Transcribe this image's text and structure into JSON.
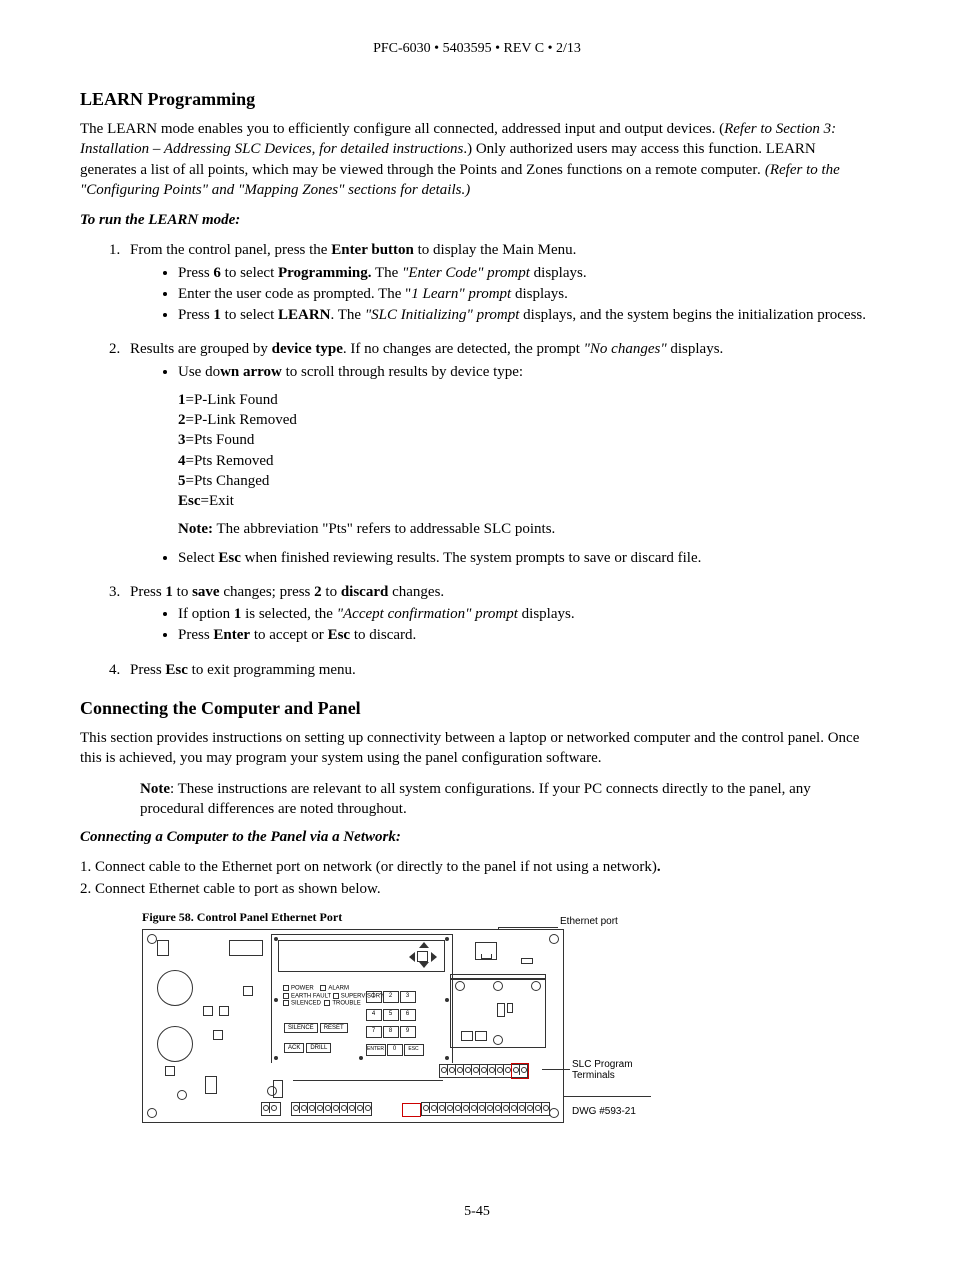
{
  "header": "PFC-6030 • 5403595 • REV C  • 2/13",
  "h1": "LEARN Programming",
  "p1a": "The LEARN mode enables you to efficiently configure all connected, addressed input and output devices. (",
  "p1b": "Refer to Section 3: Installation – Addressing SLC Devices, for detailed instructions",
  "p1c": ".) Only authorized users may access this function. LEARN generates a list of all points, which may be viewed through the Points and Zones functions on a remote computer",
  "p1d": ". (Refer to the \"Configuring Points\" and \"Mapping Zones\" sections for details.)",
  "sub1": "To run the LEARN mode:",
  "s1_lead_a": "From the control panel, press the ",
  "s1_lead_b": "Enter button",
  "s1_lead_c": " to display the Main Menu.",
  "s1_b1a": "Press ",
  "s1_b1b": "6",
  "s1_b1c": " to select ",
  "s1_b1d": "Programming.",
  "s1_b1e": " The ",
  "s1_b1f": "\"Enter Code\" prompt",
  "s1_b1g": " displays.",
  "s1_b2a": "Enter the user code as prompted. The \"",
  "s1_b2b": "1 Learn\" prompt",
  "s1_b2c": " displays.",
  "s1_b3a": "Press ",
  "s1_b3b": "1",
  "s1_b3c": " to select ",
  "s1_b3d": "LEARN",
  "s1_b3e": ". The ",
  "s1_b3f": "\"SLC Initializing\" prompt",
  "s1_b3g": " displays, and the system begins the initialization process.",
  "s2_lead_a": "Results are grouped by ",
  "s2_lead_b": "device type",
  "s2_lead_c": ". If no changes are detected, the prompt ",
  "s2_lead_d": "\"No changes\"",
  "s2_lead_e": " displays.",
  "s2_b1a": "Use do",
  "s2_b1b": "wn arrow",
  "s2_b1c": " to scroll through results by device type:",
  "codes": [
    {
      "k": "1",
      "v": "=P-Link Found"
    },
    {
      "k": "2",
      "v": "=P-Link Removed"
    },
    {
      "k": "3",
      "v": "=Pts Found"
    },
    {
      "k": "4",
      "v": "=Pts Removed"
    },
    {
      "k": "5",
      "v": "=Pts Changed"
    },
    {
      "k": "Esc",
      "v": "=Exit"
    }
  ],
  "note1a": "Note:",
  "note1b": " The abbreviation \"Pts\" refers to addressable SLC points.",
  "s2_b2a": "Select ",
  "s2_b2b": "Esc",
  "s2_b2c": " when finished reviewing results. The system prompts to save or discard file.",
  "s3_lead_a": "Press ",
  "s3_lead_b": "1",
  "s3_lead_c": " to ",
  "s3_lead_d": "save",
  "s3_lead_e": " changes; press ",
  "s3_lead_f": "2",
  "s3_lead_g": " to ",
  "s3_lead_h": "discard",
  "s3_lead_i": " changes.",
  "s3_b1a": "If option ",
  "s3_b1b": "1",
  "s3_b1c": " is selected, the ",
  "s3_b1d": "\"Accept confirmation\" prompt",
  "s3_b1e": " displays.",
  "s3_b2a": "Press ",
  "s3_b2b": "Enter",
  "s3_b2c": " to accept or ",
  "s3_b2d": "Esc",
  "s3_b2e": " to discard.",
  "s4a": "Press ",
  "s4b": "Esc",
  "s4c": " to exit programming menu.",
  "h2": "Connecting the Computer and Panel",
  "p2": "This section provides instructions on setting up connectivity between a laptop or networked computer and the control panel. Once this is achieved, you may program your system using the panel configuration software.",
  "note2a": "Note",
  "note2b": ": These instructions are relevant to all system configurations. If your PC connects directly to the panel, any procedural differences are noted throughout.",
  "sub2": "Connecting a Computer to the Panel via a Network:",
  "net1a": "1. Connect cable to the Ethernet port on network (or directly to the panel if not using a network)",
  "net1b": ".",
  "net2": "2. Connect Ethernet cable to port as shown below.",
  "figcap": "Figure 58. Control Panel Ethernet Port",
  "call_eth": "Ethernet port",
  "call_slc1": "SLC Program",
  "call_slc2": "Terminals",
  "call_dwg": "DWG #593-21",
  "leds": {
    "power": "POWER",
    "alarm": "ALARM",
    "ef": "EARTH FAULT",
    "sup": "SUPERVISORY",
    "sil": "SILENCED",
    "trb": "TROUBLE"
  },
  "btns": {
    "silence": "SILENCE",
    "reset": "RESET",
    "ack": "ACK",
    "drill": "DRILL"
  },
  "keys": {
    "enter": "ENTER",
    "esc": "ESC"
  },
  "pgnum": "5-45"
}
